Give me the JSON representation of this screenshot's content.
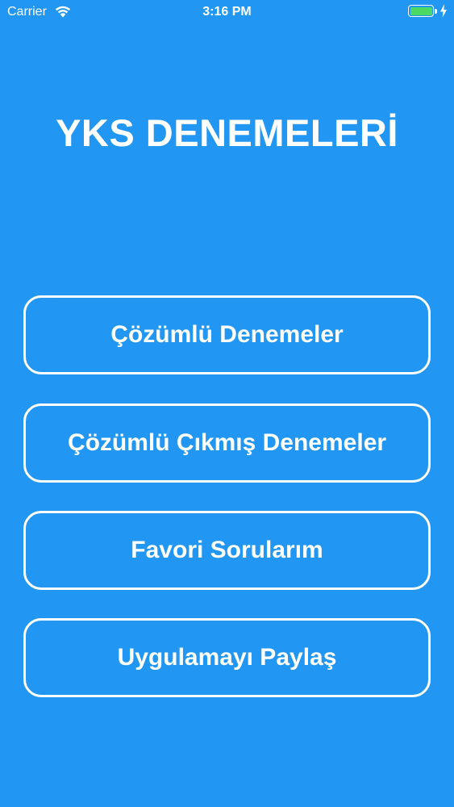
{
  "status_bar": {
    "carrier": "Carrier",
    "time": "3:16 PM",
    "battery_color": "#4CD964",
    "icons": [
      "wifi-icon",
      "battery-icon",
      "charging-icon"
    ]
  },
  "app": {
    "title": "YKS DENEMELERİ",
    "background_color": "#2196F3"
  },
  "menu": {
    "items": [
      {
        "label": "Çözümlü Denemeler"
      },
      {
        "label": "Çözümlü Çıkmış Denemeler"
      },
      {
        "label": "Favori Sorularım"
      },
      {
        "label": "Uygulamayı Paylaş"
      }
    ]
  }
}
